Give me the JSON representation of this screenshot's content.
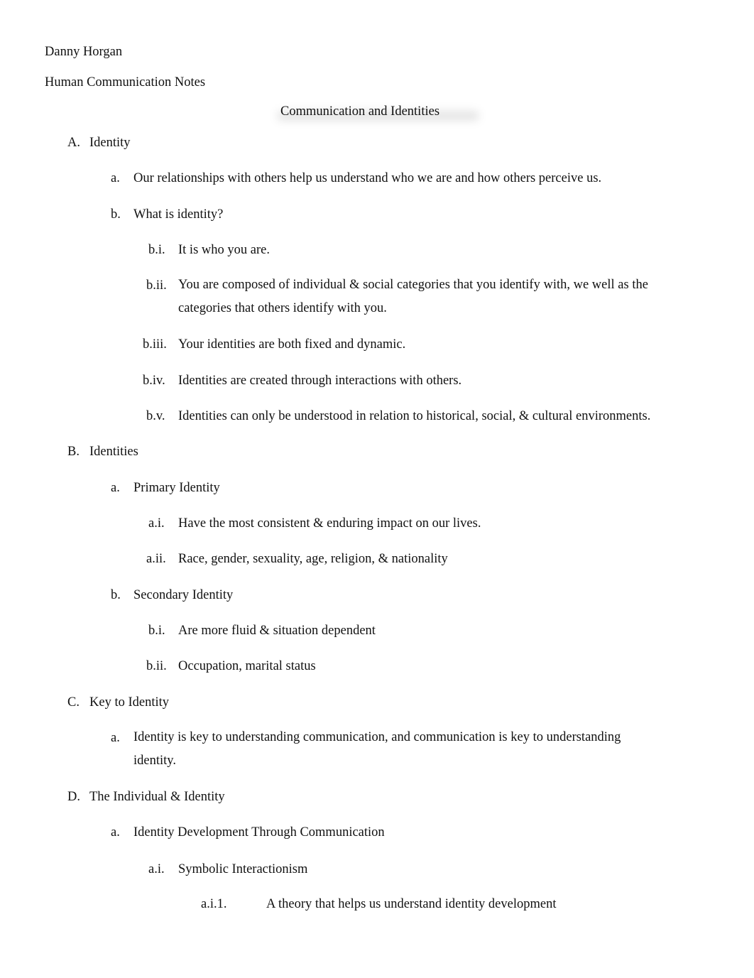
{
  "header": {
    "author": "Danny Horgan",
    "course": "Human Communication Notes",
    "title": "Communication and Identities"
  },
  "outline": {
    "A": {
      "marker": "A.",
      "label": "Identity",
      "a": {
        "marker": "a.",
        "text": "Our relationships with others help us understand who we are and how others perceive us."
      },
      "b": {
        "marker": "b.",
        "text": "What is identity?",
        "i": {
          "marker": "b.i.",
          "text": "It is who you are."
        },
        "ii": {
          "marker": "b.ii.",
          "text": "You are composed of individual & social categories that you identify with, we well as the categories that others identify with you."
        },
        "iii": {
          "marker": "b.iii.",
          "text": "Your identities are both fixed and dynamic."
        },
        "iv": {
          "marker": "b.iv.",
          "text": "Identities are created through interactions with others."
        },
        "v": {
          "marker": "b.v.",
          "text": "Identities can only be understood in relation to historical, social, & cultural environments."
        }
      }
    },
    "B": {
      "marker": "B.",
      "label": "Identities",
      "a": {
        "marker": "a.",
        "text": "Primary Identity",
        "i": {
          "marker": "a.i.",
          "text": "Have the most consistent & enduring impact on our lives."
        },
        "ii": {
          "marker": "a.ii.",
          "text": "Race, gender, sexuality, age, religion, & nationality"
        }
      },
      "b": {
        "marker": "b.",
        "text": "Secondary Identity",
        "i": {
          "marker": "b.i.",
          "text": "Are more fluid & situation dependent"
        },
        "ii": {
          "marker": "b.ii.",
          "text": "Occupation, marital status"
        }
      }
    },
    "C": {
      "marker": "C.",
      "label": "Key to Identity",
      "a": {
        "marker": "a.",
        "text": "Identity is key to understanding communication, and communication is key to understanding identity."
      }
    },
    "D": {
      "marker": "D.",
      "label": "The Individual & Identity",
      "a": {
        "marker": "a.",
        "text": "Identity Development Through Communication",
        "i": {
          "marker": "a.i.",
          "text": "Symbolic Interactionism",
          "1": {
            "marker": "a.i.1.",
            "text": "A theory that helps us understand identity development"
          }
        }
      }
    }
  }
}
